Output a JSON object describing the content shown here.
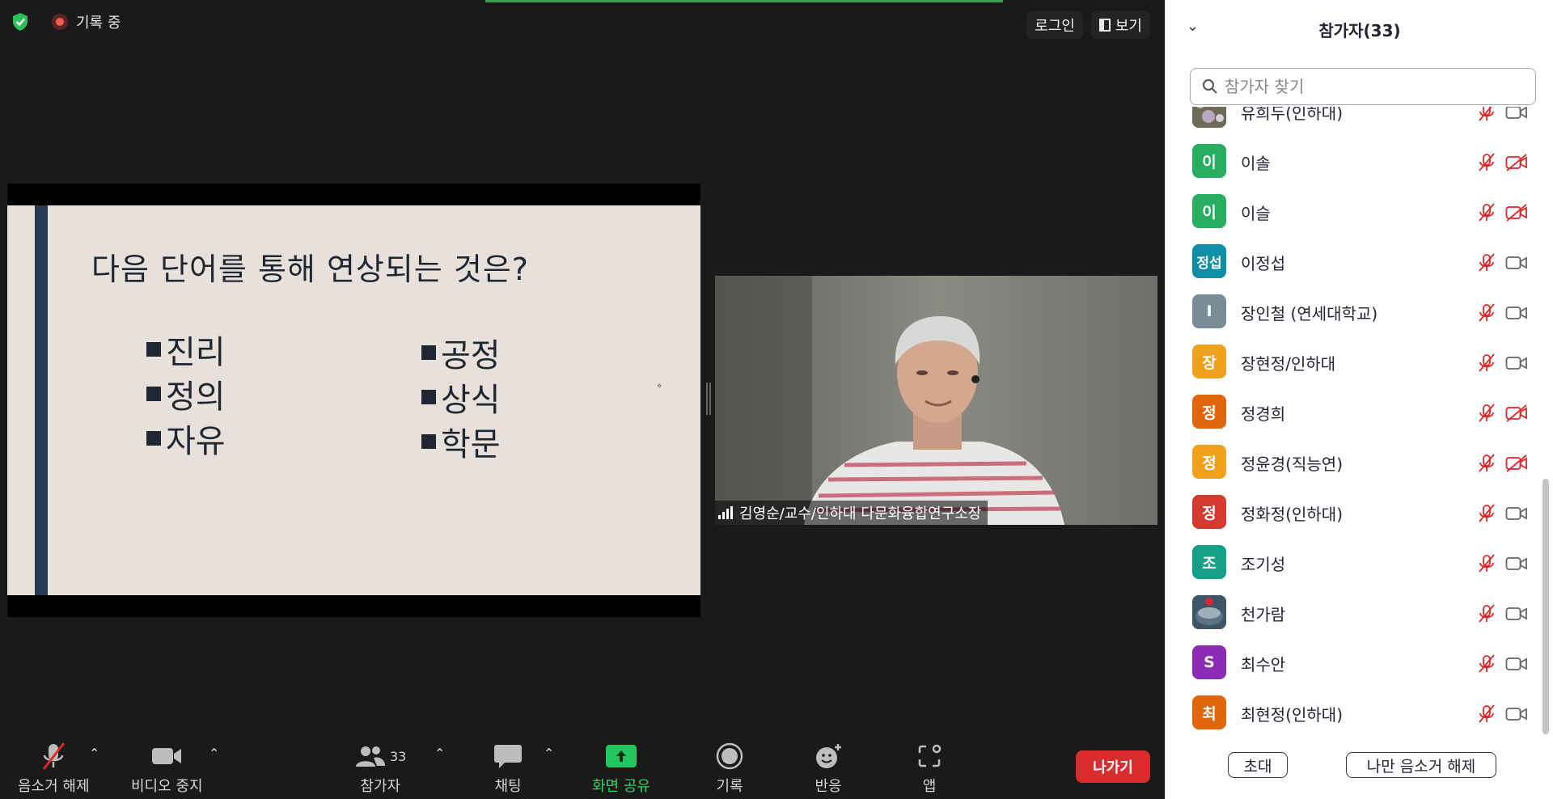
{
  "colors": {
    "meeting_bg": "#1a1a1a",
    "accent_green": "#22c55e",
    "leave_red": "#d92d2d",
    "mic_muted_red": "#e02828",
    "slide_bg": "#e8e1db",
    "slide_bar": "#263a52"
  },
  "topbar": {
    "recording_label": "기록 중",
    "login_label": "로그인",
    "view_label": "보기"
  },
  "slide": {
    "title": "다음 단어를 통해 연상되는 것은?",
    "column1": [
      "진리",
      "정의",
      "자유"
    ],
    "column2": [
      "공정",
      "상식",
      "학문"
    ]
  },
  "video": {
    "name": "김영순/교수/인하대 다문화융합연구소장"
  },
  "toolbar": {
    "mute": "음소거 해제",
    "video": "비디오 중지",
    "participants": "참가자",
    "participants_count": "33",
    "chat": "채팅",
    "share": "화면 공유",
    "record": "기록",
    "reactions": "반응",
    "apps": "앱",
    "leave": "나가기"
  },
  "panel": {
    "title": "참가자(33)",
    "search_placeholder": "참가자 찾기",
    "participants": [
      {
        "name": "유희두(인하대)",
        "avatar": "",
        "avatar_type": "photo-flowers",
        "color": "#6a6a5a",
        "mic": "muted",
        "cam": "on"
      },
      {
        "name": "이솔",
        "avatar": "이",
        "avatar_type": "initial",
        "color": "#27ae60",
        "mic": "muted",
        "cam": "off"
      },
      {
        "name": "이슬",
        "avatar": "이",
        "avatar_type": "initial",
        "color": "#27ae60",
        "mic": "muted",
        "cam": "off"
      },
      {
        "name": "이정섭",
        "avatar": "정섭",
        "avatar_type": "initial",
        "color": "#0e8fa5",
        "mic": "muted",
        "cam": "on"
      },
      {
        "name": "장인철 (연세대학교)",
        "avatar": "I",
        "avatar_type": "initial",
        "color": "#7a8c98",
        "mic": "muted",
        "cam": "on"
      },
      {
        "name": "장현정/인하대",
        "avatar": "장",
        "avatar_type": "initial",
        "color": "#f0a11c",
        "mic": "muted",
        "cam": "on"
      },
      {
        "name": "정경희",
        "avatar": "정",
        "avatar_type": "initial",
        "color": "#e0650d",
        "mic": "muted",
        "cam": "off"
      },
      {
        "name": "정윤경(직능연)",
        "avatar": "정",
        "avatar_type": "initial",
        "color": "#f0a11c",
        "mic": "muted",
        "cam": "off"
      },
      {
        "name": "정화정(인하대)",
        "avatar": "정",
        "avatar_type": "initial",
        "color": "#d63a2f",
        "mic": "muted",
        "cam": "on"
      },
      {
        "name": "조기성",
        "avatar": "조",
        "avatar_type": "initial",
        "color": "#15a085",
        "mic": "muted",
        "cam": "on"
      },
      {
        "name": "천가람",
        "avatar": "",
        "avatar_type": "photo-cake",
        "color": "#3d5566",
        "mic": "muted",
        "cam": "on"
      },
      {
        "name": "최수안",
        "avatar": "S",
        "avatar_type": "initial",
        "color": "#8e2bb5",
        "mic": "muted",
        "cam": "on"
      },
      {
        "name": "최현정(인하대)",
        "avatar": "최",
        "avatar_type": "initial",
        "color": "#e0650d",
        "mic": "muted",
        "cam": "on"
      }
    ],
    "invite_label": "초대",
    "unmute_me_label": "나만 음소거 해제"
  }
}
